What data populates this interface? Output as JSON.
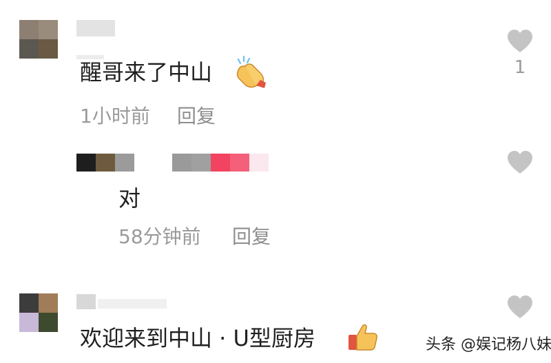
{
  "comments": [
    {
      "text": "醒哥来了中山",
      "time": "1小时前",
      "reply_label": "回复",
      "like_count": "1",
      "emoji": "clapping-hands-icon"
    },
    {
      "text": "对",
      "time": "58分钟前",
      "reply_label": "回复",
      "like_count": ""
    },
    {
      "text": "欢迎来到中山 · U型厨房",
      "like_count": "",
      "emoji": "thumbs-up-icon"
    }
  ],
  "watermark": "头条 @娱记杨八妹",
  "colors": {
    "text": "#1f1f1f",
    "meta": "#9a9a9a",
    "heart": "#c4c4c4"
  }
}
